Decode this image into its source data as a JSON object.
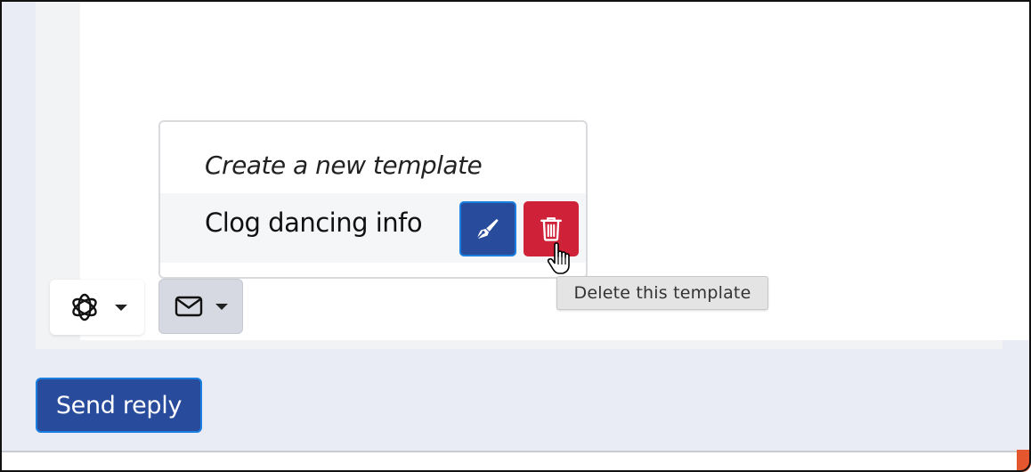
{
  "editor": {
    "dropdown": {
      "new_template_label": "Create a new template",
      "templates": [
        {
          "label": "Clog dancing info"
        }
      ]
    },
    "toolbar": {
      "ai_icon": "openai-icon",
      "template_icon": "envelope-icon"
    }
  },
  "tooltip": {
    "text": "Delete this template"
  },
  "actions": {
    "send_label": "Send reply"
  },
  "colors": {
    "primary": "#284b9c",
    "danger": "#cf2238",
    "focus_ring": "#1a7fe0",
    "page_background": "#e9ecf4"
  }
}
